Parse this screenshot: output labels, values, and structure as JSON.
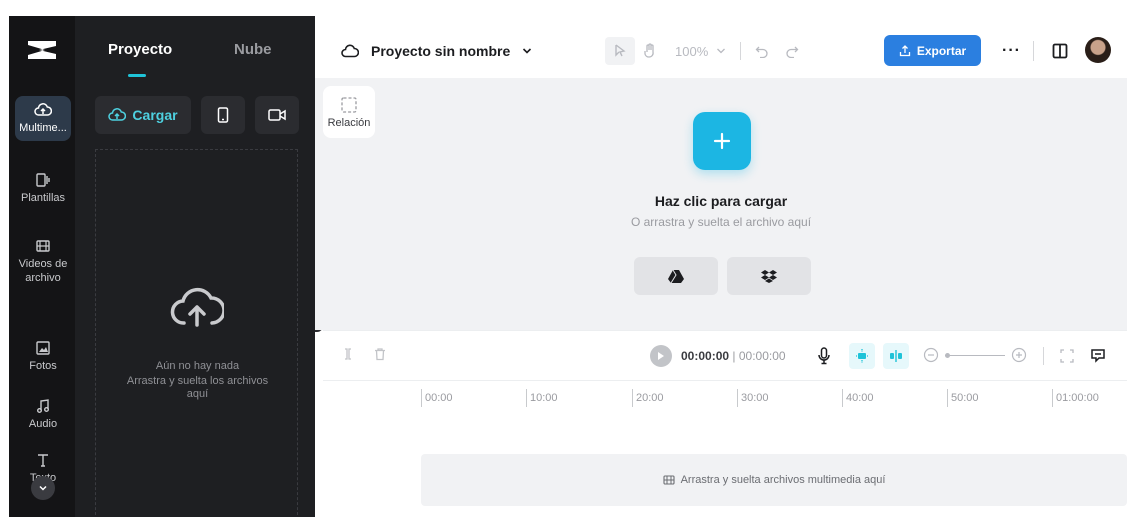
{
  "rail": {
    "items": [
      {
        "label": "Multime..."
      },
      {
        "label": "Plantillas"
      },
      {
        "label": "Videos de archivo"
      },
      {
        "label": "Fotos"
      },
      {
        "label": "Audio"
      },
      {
        "label": "Texto"
      }
    ]
  },
  "panel": {
    "tabs": [
      {
        "label": "Proyecto"
      },
      {
        "label": "Nube"
      }
    ],
    "upload_label": "Cargar",
    "empty_title": "Aún no hay nada",
    "empty_hint": "Arrastra y suelta los archivos aquí"
  },
  "topbar": {
    "project_name": "Proyecto sin nombre",
    "zoom": "100%",
    "export_label": "Exportar",
    "more_label": "···"
  },
  "canvas": {
    "ratio_label": "Relación",
    "cta_title": "Haz clic para cargar",
    "cta_sub": "O arrastra y suelta el archivo aquí"
  },
  "timeline": {
    "current_time": "00:00:00",
    "separator": "|",
    "total_time": "00:00:00",
    "ruler": [
      "00:00",
      "10:00",
      "20:00",
      "30:00",
      "40:00",
      "50:00",
      "01:00:00"
    ],
    "track_hint": "Arrastra y suelta archivos multimedia aquí"
  },
  "colors": {
    "accent": "#1cb6e3",
    "export": "#2b7fe0",
    "panel_bg": "#1e1f22",
    "rail_bg": "#141416"
  }
}
